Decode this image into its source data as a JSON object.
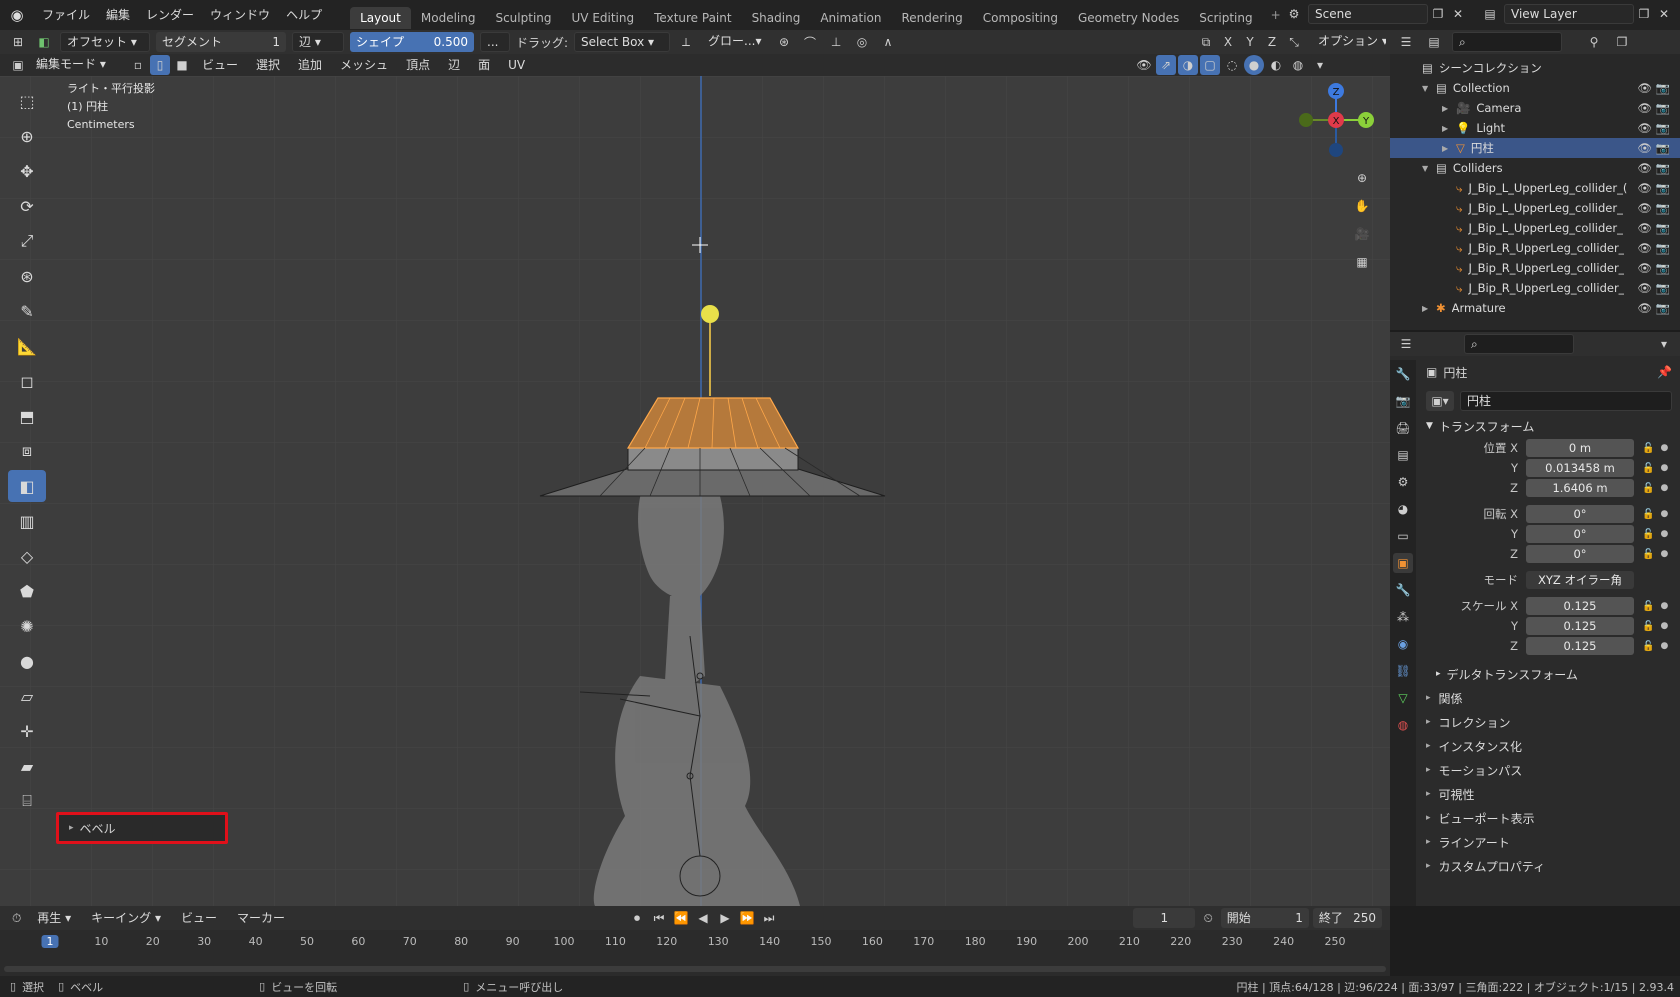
{
  "app": {
    "logo": "blender-logo-icon",
    "menus": [
      "ファイル",
      "編集",
      "レンダー",
      "ウィンドウ",
      "ヘルプ"
    ],
    "workspaces": [
      "Layout",
      "Modeling",
      "Sculpting",
      "UV Editing",
      "Texture Paint",
      "Shading",
      "Animation",
      "Rendering",
      "Compositing",
      "Geometry Nodes",
      "Scripting"
    ],
    "add_workspace": "+",
    "scene": "Scene",
    "view_layer": "View Layer"
  },
  "tool_header": {
    "offset_mode": "オフセット",
    "segments_label": "セグメント",
    "segments_value": "1",
    "affect": "辺",
    "shape_label": "シェイプ",
    "shape_value": "0.500",
    "more": "...",
    "drag_label": "ドラッグ:",
    "drag_value": "Select Box",
    "orientation": "グロー...",
    "options": "オプション"
  },
  "view_header": {
    "mode": "編集モード",
    "menus": [
      "ビュー",
      "選択",
      "追加",
      "メッシュ",
      "頂点",
      "辺",
      "面",
      "UV"
    ]
  },
  "axis_labels": [
    "X",
    "Y",
    "Z"
  ],
  "viewport": {
    "info_line1": "ライト・平行投影",
    "info_line2": "(1) 円柱",
    "info_line3": "Centimeters",
    "gizmo": {
      "z": "Z",
      "x": "X",
      "y": "Y"
    },
    "last_op_panel": "ベベル"
  },
  "outliner": {
    "root": "シーンコレクション",
    "items": [
      {
        "name": "Collection",
        "level": 1,
        "kind": "collection"
      },
      {
        "name": "Camera",
        "level": 2,
        "kind": "camera"
      },
      {
        "name": "Light",
        "level": 2,
        "kind": "light"
      },
      {
        "name": "円柱",
        "level": 2,
        "kind": "mesh",
        "selected": true
      },
      {
        "name": "Colliders",
        "level": 1,
        "kind": "collection"
      },
      {
        "name": "J_Bip_L_UpperLeg_collider_(",
        "level": 2,
        "kind": "empty"
      },
      {
        "name": "J_Bip_L_UpperLeg_collider_",
        "level": 2,
        "kind": "empty"
      },
      {
        "name": "J_Bip_L_UpperLeg_collider_",
        "level": 2,
        "kind": "empty"
      },
      {
        "name": "J_Bip_R_UpperLeg_collider_",
        "level": 2,
        "kind": "empty"
      },
      {
        "name": "J_Bip_R_UpperLeg_collider_",
        "level": 2,
        "kind": "empty"
      },
      {
        "name": "J_Bip_R_UpperLeg_collider_",
        "level": 2,
        "kind": "empty"
      },
      {
        "name": "Armature",
        "level": 1,
        "kind": "armature"
      }
    ]
  },
  "properties": {
    "object_name": "円柱",
    "datablock": "円柱",
    "transform_title": "トランスフォーム",
    "location_label": "位置 X",
    "location": [
      "0 m",
      "0.013458 m",
      "1.6406 m"
    ],
    "rotation_label": "回転 X",
    "rotation": [
      "0°",
      "0°",
      "0°"
    ],
    "mode_label": "モード",
    "mode_value": "XYZ オイラー角",
    "scale_label": "スケール X",
    "scale": [
      "0.125",
      "0.125",
      "0.125"
    ],
    "delta": "デルタトランスフォーム",
    "sections": [
      "関係",
      "コレクション",
      "インスタンス化",
      "モーションパス",
      "可視性",
      "ビューポート表示",
      "ラインアート",
      "カスタムプロパティ"
    ]
  },
  "timeline": {
    "menus": [
      "再生",
      "キーイング",
      "ビュー",
      "マーカー"
    ],
    "current_frame": "1",
    "start_label": "開始",
    "start": "1",
    "end_label": "終了",
    "end": "250",
    "ticks": [
      "1",
      "10",
      "20",
      "30",
      "40",
      "50",
      "60",
      "70",
      "80",
      "90",
      "100",
      "110",
      "120",
      "130",
      "140",
      "150",
      "160",
      "170",
      "180",
      "190",
      "200",
      "210",
      "220",
      "230",
      "240",
      "250"
    ]
  },
  "statusbar": {
    "select": "選択",
    "bevel": "ベベル",
    "rotate": "ビューを回転",
    "menu": "メニュー呼び出し",
    "stats": "円柱 | 頂点:64/128 | 辺:96/224 | 面:33/97 | 三角面:222 | オブジェクト:1/15 | 2.93.4"
  }
}
